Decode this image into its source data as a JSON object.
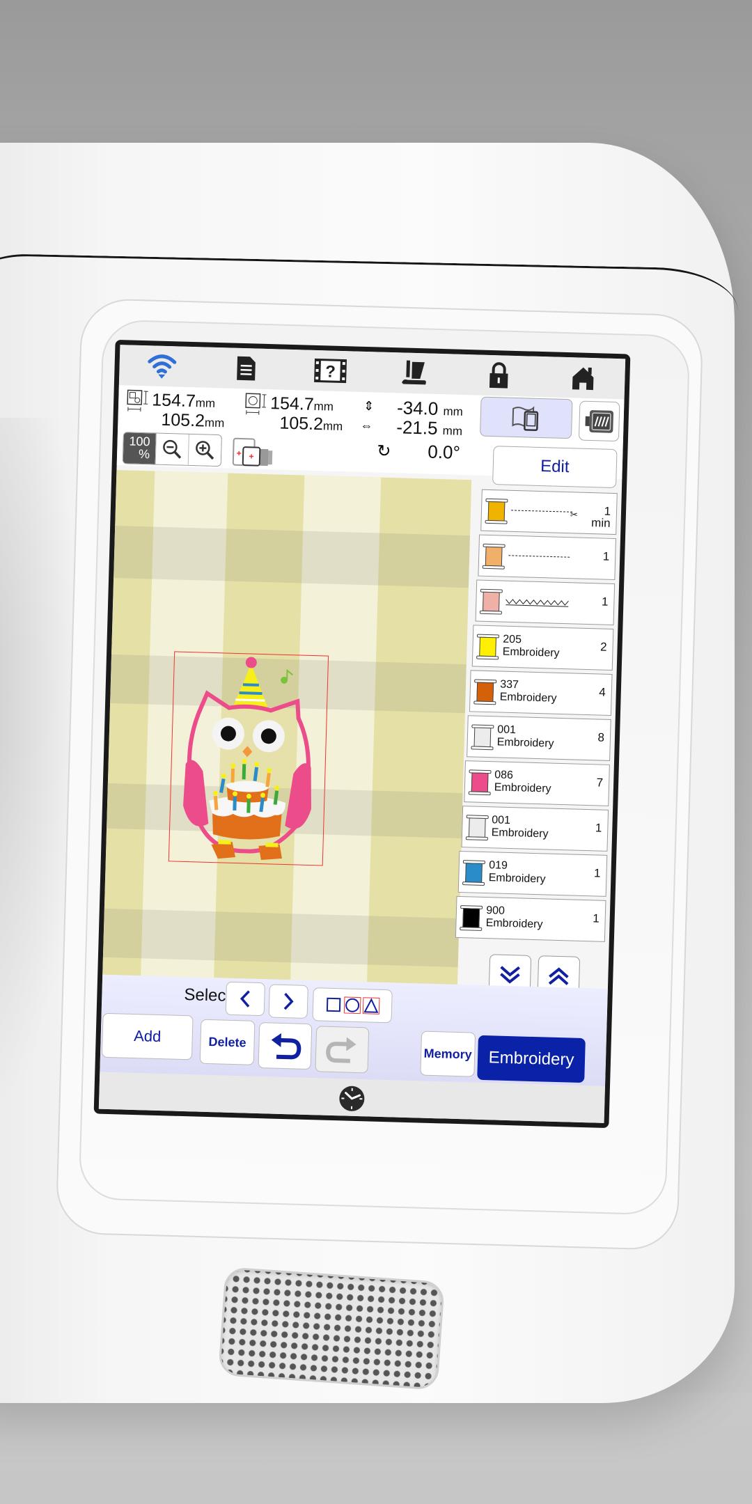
{
  "topbar": {
    "icons": [
      {
        "name": "wifi-icon",
        "color": "#2f6fd6"
      },
      {
        "name": "document-icon"
      },
      {
        "name": "help-video-icon",
        "label": "?"
      },
      {
        "name": "presser-foot-icon"
      },
      {
        "name": "lock-icon"
      },
      {
        "name": "home-icon"
      }
    ]
  },
  "info": {
    "pattern_size": {
      "height": "154.7",
      "width": "105.2",
      "unit": "mm"
    },
    "hoop_size": {
      "height": "154.7",
      "width": "105.2",
      "unit": "mm"
    },
    "position": {
      "vertical": "-34.0",
      "horizontal": "-21.5",
      "unit": "mm"
    },
    "rotation": "0.0°",
    "zoom": {
      "value": "100",
      "unit": "%"
    }
  },
  "buttons": {
    "edit": "Edit",
    "select_label": "Select",
    "add": "Add",
    "delete": "Delete",
    "memory": "Memory",
    "embroidery": "Embroidery"
  },
  "threads": [
    {
      "type": "stitch",
      "stitch": "straight-cut",
      "color": "#f0b400",
      "count": "1",
      "sub": "min"
    },
    {
      "type": "stitch",
      "stitch": "straight",
      "color": "#f1b06a",
      "count": "1"
    },
    {
      "type": "stitch",
      "stitch": "zigzag",
      "color": "#efb0a8",
      "count": "1"
    },
    {
      "type": "thread",
      "number": "205",
      "name": "Embroidery",
      "color": "#ffef00",
      "count": "2"
    },
    {
      "type": "thread",
      "number": "337",
      "name": "Embroidery",
      "color": "#d4600a",
      "count": "4"
    },
    {
      "type": "thread",
      "number": "001",
      "name": "Embroidery",
      "color": "#ececec",
      "count": "8"
    },
    {
      "type": "thread",
      "number": "086",
      "name": "Embroidery",
      "color": "#ec4d8a",
      "count": "7"
    },
    {
      "type": "thread",
      "number": "001",
      "name": "Embroidery",
      "color": "#ececec",
      "count": "1"
    },
    {
      "type": "thread",
      "number": "019",
      "name": "Embroidery",
      "color": "#2a8cc8",
      "count": "1"
    },
    {
      "type": "thread",
      "number": "900",
      "name": "Embroidery",
      "color": "#000000",
      "count": "1"
    }
  ],
  "colors": {
    "accent": "#0a22a8",
    "view_button_bg": "#dfe2fa",
    "toolbar_bg": "#e3e4fa",
    "design_frame": "#e33333"
  }
}
